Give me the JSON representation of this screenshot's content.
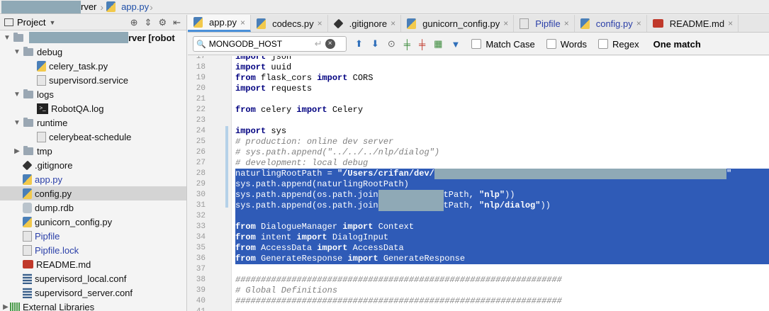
{
  "breadcrumb": {
    "project_suffix": "rver",
    "file": "app.py"
  },
  "project_panel": {
    "title": "Project",
    "root_suffix": "rver [robot",
    "tree": [
      {
        "label": "debug",
        "type": "folder",
        "level": 1,
        "expanded": true
      },
      {
        "label": "celery_task.py",
        "type": "py",
        "level": 2
      },
      {
        "label": "supervisord.service",
        "type": "txt",
        "level": 2
      },
      {
        "label": "logs",
        "type": "folder",
        "level": 1,
        "expanded": true
      },
      {
        "label": "RobotQA.log",
        "type": "log",
        "level": 2
      },
      {
        "label": "runtime",
        "type": "folder",
        "level": 1,
        "expanded": true
      },
      {
        "label": "celerybeat-schedule",
        "type": "txt",
        "level": 2
      },
      {
        "label": "tmp",
        "type": "folder",
        "level": 1,
        "expanded": false
      },
      {
        "label": ".gitignore",
        "type": "git",
        "level": 1
      },
      {
        "label": "app.py",
        "type": "py",
        "level": 1,
        "blue": true
      },
      {
        "label": "config.py",
        "type": "py",
        "level": 1,
        "selected": true
      },
      {
        "label": "dump.rdb",
        "type": "db",
        "level": 1
      },
      {
        "label": "gunicorn_config.py",
        "type": "py",
        "level": 1
      },
      {
        "label": "Pipfile",
        "type": "txt",
        "level": 1,
        "blue": true
      },
      {
        "label": "Pipfile.lock",
        "type": "txt",
        "level": 1,
        "blue": true
      },
      {
        "label": "README.md",
        "type": "md",
        "level": 1
      },
      {
        "label": "supervisord_local.conf",
        "type": "conf",
        "level": 1
      },
      {
        "label": "supervisord_server.conf",
        "type": "conf",
        "level": 1
      },
      {
        "label": "External Libraries",
        "type": "lib",
        "level": 0
      }
    ]
  },
  "tabs": [
    {
      "label": "app.py",
      "active": true,
      "close": "×"
    },
    {
      "label": "codecs.py",
      "close": "×"
    },
    {
      "label": ".gitignore",
      "close": "×"
    },
    {
      "label": "gunicorn_config.py",
      "close": "×"
    },
    {
      "label": "Pipfile",
      "close": "×",
      "blue": true
    },
    {
      "label": "config.py",
      "close": "×",
      "blue": true
    },
    {
      "label": "README.md",
      "close": "×"
    }
  ],
  "search": {
    "value": "MONGODB_HOST",
    "match_case": "Match Case",
    "words": "Words",
    "regex": "Regex",
    "result": "One match"
  },
  "editor": {
    "lines": [
      {
        "n": "17",
        "text": "import json",
        "kind": "partial"
      },
      {
        "n": "18",
        "text": "import uuid",
        "kind": "import"
      },
      {
        "n": "19",
        "text": "from flask_cors import CORS",
        "kind": "from"
      },
      {
        "n": "20",
        "text": "import requests",
        "kind": "import"
      },
      {
        "n": "21",
        "text": "",
        "kind": "plain"
      },
      {
        "n": "22",
        "text": "from celery import Celery",
        "kind": "from"
      },
      {
        "n": "23",
        "text": "",
        "kind": "plain"
      },
      {
        "n": "24",
        "text": "import sys",
        "kind": "import"
      },
      {
        "n": "25",
        "text": "# production: online dev server",
        "kind": "comment"
      },
      {
        "n": "26",
        "text": "# sys.path.append(\"../../../nlp/dialog\")",
        "kind": "comment"
      },
      {
        "n": "27",
        "text": "# development: local debug",
        "kind": "comment"
      },
      {
        "n": "28",
        "text": "naturlingRootPath = \"/Users/crifan/dev/",
        "kind": "sel",
        "tail": "\""
      },
      {
        "n": "29",
        "text": "sys.path.append(naturlingRootPath)",
        "kind": "sel"
      },
      {
        "n": "30",
        "text": "sys.path.append(os.path.join",
        "kind": "sel",
        "tail": "tPath, \"nlp\"))"
      },
      {
        "n": "31",
        "text": "sys.path.append(os.path.join",
        "kind": "sel",
        "tail": "tPath, \"nlp/dialog\"))"
      },
      {
        "n": "32",
        "text": "",
        "kind": "sel"
      },
      {
        "n": "33",
        "text": "from DialogueManager import Context",
        "kind": "selfrom"
      },
      {
        "n": "34",
        "text": "from intent import DialogInput",
        "kind": "selfrom"
      },
      {
        "n": "35",
        "text": "from AccessData import AccessData",
        "kind": "selfrom"
      },
      {
        "n": "36",
        "text": "from GenerateResponse import GenerateResponse",
        "kind": "selfrom"
      },
      {
        "n": "37",
        "text": "",
        "kind": "plain"
      },
      {
        "n": "38",
        "text": "################################################################",
        "kind": "comment"
      },
      {
        "n": "39",
        "text": "# Global Definitions",
        "kind": "comment"
      },
      {
        "n": "40",
        "text": "################################################################",
        "kind": "comment"
      },
      {
        "n": "41",
        "text": "",
        "kind": "plain"
      }
    ]
  }
}
